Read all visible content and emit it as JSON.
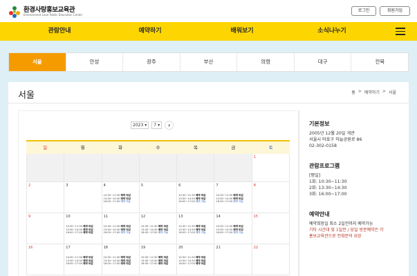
{
  "header": {
    "logo_title": "환경사랑홍보교육관",
    "logo_sub": "Environment Love Public Education Center",
    "login_label": "로그인",
    "join_label": "회원가입"
  },
  "nav": {
    "items": [
      "관람안내",
      "예약하기",
      "배워보기",
      "소식나누기"
    ]
  },
  "tabs": {
    "items": [
      "서울",
      "안성",
      "광주",
      "부산",
      "의령",
      "대구",
      "전북"
    ],
    "active_index": 0
  },
  "page": {
    "title": "서울",
    "breadcrumb": [
      "홈",
      "예약하기",
      "서울"
    ]
  },
  "calendar": {
    "year": "2023",
    "month": "7",
    "weekdays": [
      "일",
      "월",
      "화",
      "수",
      "목",
      "금",
      "토"
    ],
    "slot_times": [
      "10:30~11:30",
      "13:30~14:30",
      "16:00~17:00"
    ],
    "closed_label": "예약 마감",
    "avail_label": "예약 가능",
    "weeks": [
      [
        {
          "day": "",
          "empty": true
        },
        {
          "day": "",
          "empty": true
        },
        {
          "day": "",
          "empty": true
        },
        {
          "day": "",
          "empty": true
        },
        {
          "day": "",
          "empty": true
        },
        {
          "day": "",
          "empty": true
        },
        {
          "day": "1",
          "slots": null
        }
      ],
      [
        {
          "day": "2",
          "slots": null
        },
        {
          "day": "3",
          "slots": null
        },
        {
          "day": "4",
          "slots": [
            "closed",
            "closed",
            "avail"
          ]
        },
        {
          "day": "5",
          "slots": null
        },
        {
          "day": "6",
          "slots": [
            "closed",
            "closed",
            "avail"
          ]
        },
        {
          "day": "7",
          "slots": [
            "closed",
            "closed",
            "avail"
          ]
        },
        {
          "day": "8",
          "slots": null
        }
      ],
      [
        {
          "day": "9",
          "slots": null
        },
        {
          "day": "10",
          "slots": [
            "closed",
            "closed",
            "closed"
          ]
        },
        {
          "day": "11",
          "slots": [
            "closed",
            "closed",
            "avail"
          ]
        },
        {
          "day": "12",
          "slots": [
            "closed",
            "closed",
            "avail"
          ]
        },
        {
          "day": "13",
          "slots": [
            "closed",
            "closed",
            "avail"
          ]
        },
        {
          "day": "14",
          "slots": [
            "closed",
            "closed",
            "avail"
          ]
        },
        {
          "day": "15",
          "slots": null
        }
      ],
      [
        {
          "day": "16",
          "slots": null
        },
        {
          "day": "17",
          "slots": [
            "closed",
            "closed",
            "closed"
          ]
        },
        {
          "day": "18",
          "slots": [
            "closed",
            "closed",
            "closed"
          ]
        },
        {
          "day": "19",
          "slots": [
            "closed",
            "closed",
            "closed"
          ]
        },
        {
          "day": "20",
          "slots": [
            "closed",
            "closed",
            "closed"
          ]
        },
        {
          "day": "21",
          "slots": null
        },
        {
          "day": "22",
          "slots": null
        }
      ]
    ]
  },
  "side": {
    "basic_title": "기본정보",
    "basic_lines": [
      "2005년 12월 20일 개관",
      "서울시 마포구 하늘공원로 86",
      "02-302-0158"
    ],
    "program_title": "관람프로그램",
    "program_lines": [
      "[평일]",
      "1회: 10:30~11:30",
      "2회: 13:30~14:30",
      "3회: 16:00~17:00"
    ],
    "reserve_title": "예약안내",
    "reserve_line": "예약희망일 최소 2일전까지 예약가능",
    "reserve_red_lines": [
      "기타 시간대 및 1일전 / 당일 방문예약은 각",
      "홍보교육관으로 전화문의 요망"
    ]
  },
  "colors": {
    "nav_yellow": "#fdd500",
    "tab_active": "#f59b00",
    "sunday_red": "#d9352a",
    "saturday_blue": "#2b5cc2"
  }
}
